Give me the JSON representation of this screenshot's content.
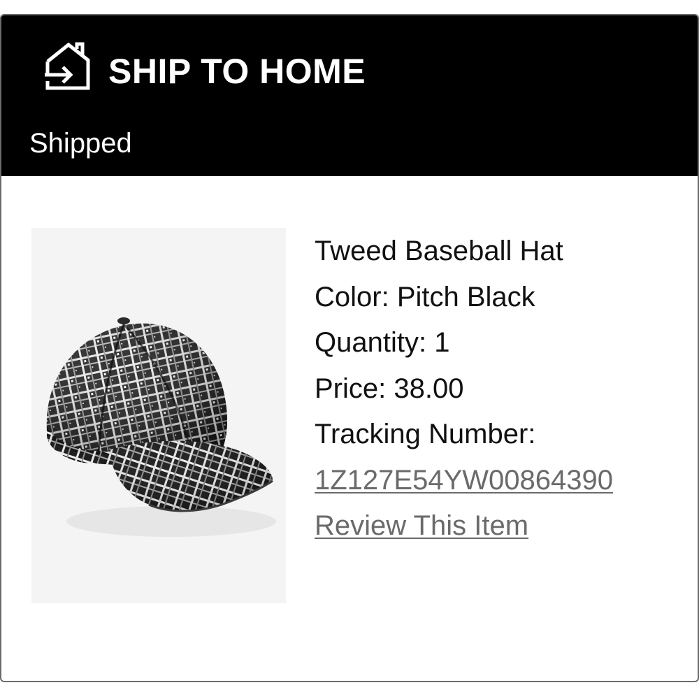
{
  "header": {
    "title": "SHIP TO HOME",
    "icon": "home-arrow-icon",
    "status": "Shipped"
  },
  "product": {
    "image": "tweed-baseball-hat-image",
    "name": "Tweed Baseball Hat",
    "color_line": "Color: Pitch Black",
    "quantity_line": "Quantity: 1",
    "price_line": "Price: 38.00",
    "tracking_label": "Tracking Number:",
    "tracking_number": "1Z127E54YW00864390",
    "review_link": "Review This Item"
  },
  "colors": {
    "header_bg": "#000000",
    "link": "#6a6a6a"
  }
}
